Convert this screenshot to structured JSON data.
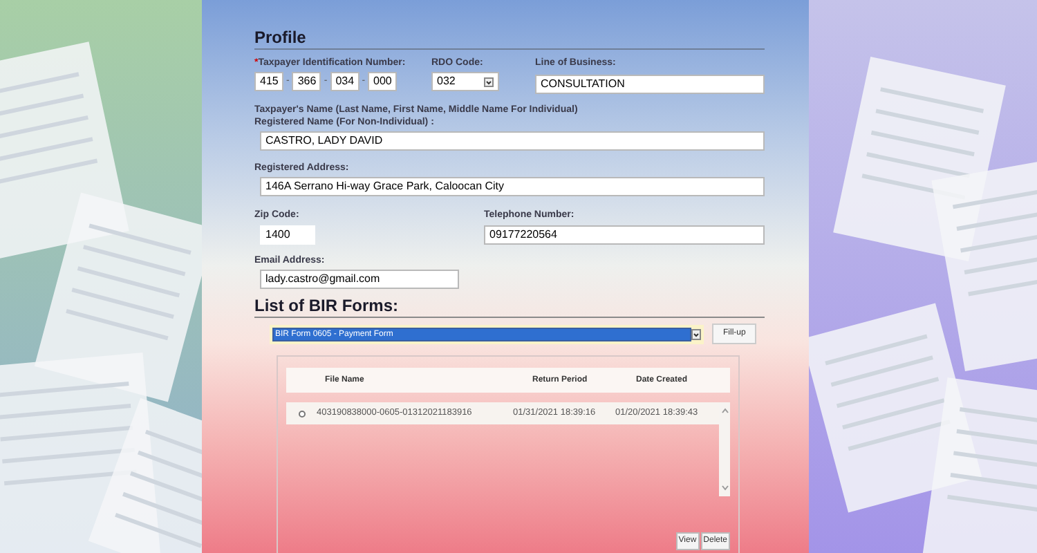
{
  "profile": {
    "title": "Profile",
    "tin": {
      "label": "Taxpayer Identification Number:",
      "required": true,
      "required_mark": "*",
      "parts": [
        "415",
        "366",
        "034",
        "000"
      ],
      "separator": "-"
    },
    "rdo": {
      "label": "RDO Code:",
      "value": "032"
    },
    "line_of_business": {
      "label": "Line of Business:",
      "value": "CONSULTATION"
    },
    "taxpayer_name": {
      "label": "Taxpayer's Name (Last Name, First Name, Middle Name For Individual)",
      "label_2": "Registered Name (For Non-Individual) :",
      "value": "CASTRO, LADY DAVID"
    },
    "address": {
      "label": "Registered Address:",
      "value": "146A Serrano Hi-way Grace Park, Caloocan City"
    },
    "zip": {
      "label": "Zip Code:",
      "value": "1400"
    },
    "telephone": {
      "label": "Telephone Number:",
      "value": "09177220564"
    },
    "email": {
      "label": "Email Address:",
      "value": "lady.castro@gmail.com"
    }
  },
  "forms": {
    "title": "List of BIR Forms:",
    "select_value": "BIR Form 0605 - Payment Form",
    "fill_button": "Fill-up",
    "table": {
      "columns": [
        "File Name",
        "Return Period",
        "Date Created"
      ],
      "rows": [
        {
          "selected": false,
          "cells": [
            "403190838000-0605-01312021183916",
            "01/31/2021 18:39:16",
            "01/20/2021 18:39:43"
          ]
        }
      ]
    },
    "buttons": [
      "View",
      "Delete"
    ]
  }
}
